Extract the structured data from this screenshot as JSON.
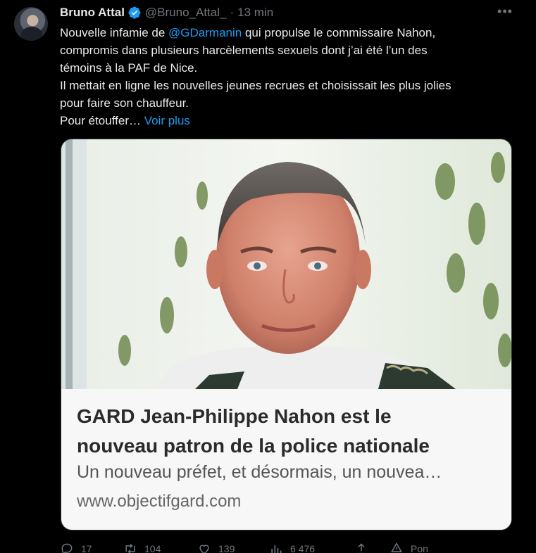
{
  "tweet": {
    "author_name": "Bruno Attal",
    "handle": "@Bruno_Attal_",
    "separator": "·",
    "time": "13 min",
    "more_label": "•••",
    "text": {
      "line1_before": "Nouvelle infamie de ",
      "mention": "@GDarmanin",
      "line1_after": " qui propulse le commissaire Nahon,",
      "line2": "compromis dans plusieurs harcèlements sexuels dont j’ai été l’un des",
      "line3": "témoins à la PAF de Nice.",
      "line4": "Il mettait en ligne les nouvelles jeunes recrues et choisissait les plus jolies",
      "line5": "pour faire son chauffeur.",
      "line6_before": "Pour étouffer… ",
      "show_more": "Voir plus"
    },
    "colors": {
      "accent": "#1d9bf0",
      "background": "#000000",
      "text": "#e7e9ea",
      "muted": "#71767b"
    }
  },
  "card": {
    "title_line1": "GARD Jean-Philippe Nahon est le",
    "title_line2": "nouveau patron de la police nationale",
    "description": "Un nouveau préfet, et désormais, un nouvea…",
    "domain": "www.objectifgard.com"
  },
  "actions": {
    "replies": "17",
    "retweets": "104",
    "likes": "139",
    "views": "6 476",
    "partial_label": "Pon"
  }
}
